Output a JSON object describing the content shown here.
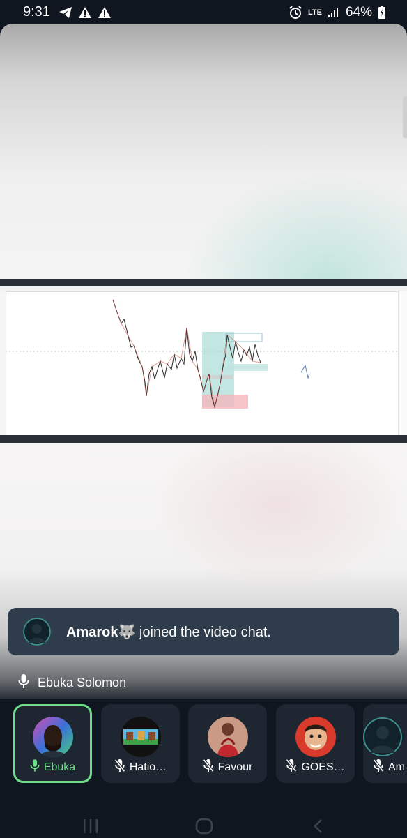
{
  "status_bar": {
    "time": "9:31",
    "network": "LTE",
    "battery": "64%"
  },
  "notification": {
    "user": "Amarok🐺",
    "text": " joined the video chat."
  },
  "speaker": {
    "name": "Ebuka Solomon"
  },
  "participants": [
    {
      "name": "Ebuka",
      "mic": "on",
      "active": true
    },
    {
      "name": "Hatio…",
      "mic": "off",
      "active": false
    },
    {
      "name": "Favour",
      "mic": "off",
      "active": false
    },
    {
      "name": "GOES…",
      "mic": "off",
      "active": false
    },
    {
      "name": "Am",
      "mic": "off",
      "active": false
    }
  ],
  "colors": {
    "active_green": "#6fe08a",
    "toast_bg": "#2e3c4b",
    "tile_bg": "#1e2731"
  },
  "icons": [
    "telegram-icon",
    "alert-icon",
    "alarm-icon",
    "signal-icon",
    "battery-icon",
    "mic-icon",
    "mic-off-icon",
    "recents-icon",
    "home-icon",
    "back-icon"
  ]
}
